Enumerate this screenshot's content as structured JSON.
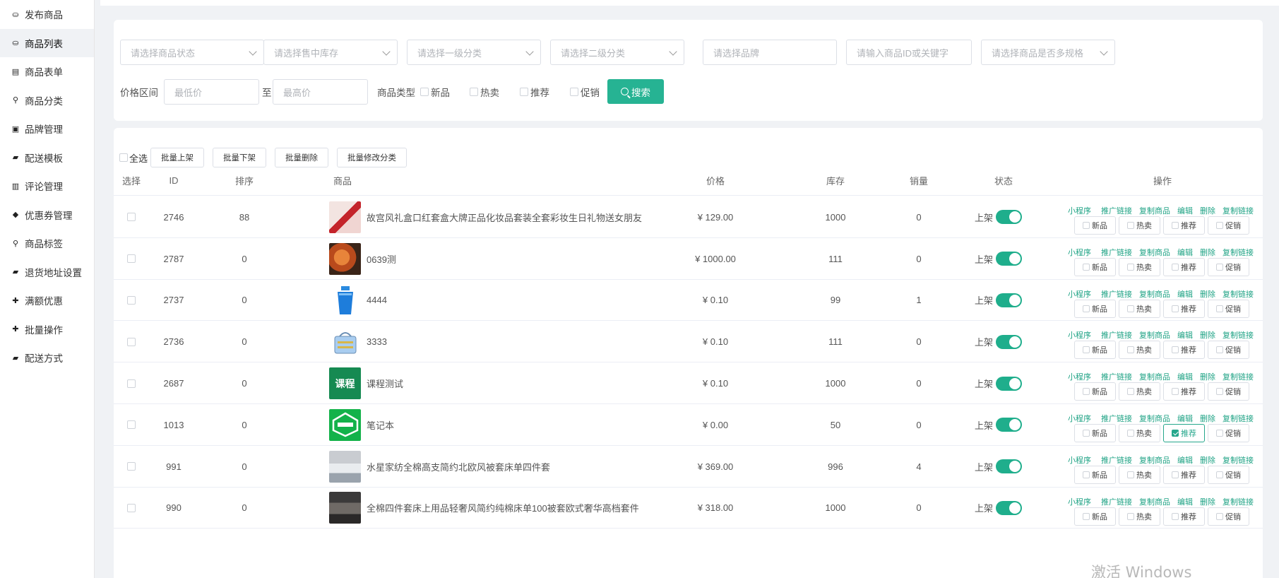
{
  "sidebar": {
    "items": [
      {
        "label": "发布商品",
        "icon": "coins-icon",
        "active": false
      },
      {
        "label": "商品列表",
        "icon": "coins-icon",
        "active": true
      },
      {
        "label": "商品表单",
        "icon": "file-excel-icon",
        "active": false
      },
      {
        "label": "商品分类",
        "icon": "sitemap-icon",
        "active": false
      },
      {
        "label": "品牌管理",
        "icon": "briefcase-icon",
        "active": false
      },
      {
        "label": "配送模板",
        "icon": "truck-icon",
        "active": false
      },
      {
        "label": "评论管理",
        "icon": "columns-icon",
        "active": false
      },
      {
        "label": "优惠券管理",
        "icon": "tags-icon",
        "active": false
      },
      {
        "label": "商品标签",
        "icon": "sitemap-icon",
        "active": false
      },
      {
        "label": "退货地址设置",
        "icon": "truck-icon",
        "active": false
      },
      {
        "label": "满额优惠",
        "icon": "gift-icon",
        "active": false
      },
      {
        "label": "批量操作",
        "icon": "gift-icon",
        "active": false
      },
      {
        "label": "配送方式",
        "icon": "truck-icon",
        "active": false
      }
    ]
  },
  "filters": {
    "status_placeholder": "请选择商品状态",
    "stock_placeholder": "请选择售中库存",
    "cat1_placeholder": "请选择一级分类",
    "cat2_placeholder": "请选择二级分类",
    "brand_placeholder": "请选择品牌",
    "keyword_placeholder": "请输入商品ID或关键字",
    "spec_placeholder": "请选择商品是否多规格",
    "price_label": "价格区间",
    "min_placeholder": "最低价",
    "to_label": "至",
    "max_placeholder": "最高价",
    "type_label": "商品类型",
    "type_new": "新品",
    "type_hot": "热卖",
    "type_rec": "推荐",
    "type_promo": "促销",
    "search_label": "搜索"
  },
  "toolbar": {
    "select_all": "全选",
    "batch_on": "批量上架",
    "batch_off": "批量下架",
    "batch_delete": "批量删除",
    "batch_category": "批量修改分类"
  },
  "table": {
    "headers": {
      "select": "选择",
      "id": "ID",
      "sort": "排序",
      "goods": "商品",
      "price": "价格",
      "stock": "库存",
      "sales": "销量",
      "status": "状态",
      "ops": "操作"
    },
    "ops_links": [
      "小程序",
      "推广链接",
      "复制商品",
      "编辑",
      "删除",
      "复制链接"
    ],
    "tag_labels": [
      "新品",
      "热卖",
      "推荐",
      "促销"
    ],
    "status_on": "上架",
    "rows": [
      {
        "id": "2746",
        "sort": "88",
        "name": "故宫风礼盒口红套盒大牌正品化妆品套装全套彩妆生日礼物送女朋友",
        "price": "¥ 129.00",
        "stock": "1000",
        "sales": "0",
        "thumb": "lipstick",
        "rec_checked": false
      },
      {
        "id": "2787",
        "sort": "0",
        "name": "0639测",
        "price": "¥ 1000.00",
        "stock": "111",
        "sales": "0",
        "thumb": "food",
        "rec_checked": false
      },
      {
        "id": "2737",
        "sort": "0",
        "name": "4444",
        "price": "¥ 0.10",
        "stock": "99",
        "sales": "1",
        "thumb": "cup",
        "rec_checked": false
      },
      {
        "id": "2736",
        "sort": "0",
        "name": "3333",
        "price": "¥ 0.10",
        "stock": "111",
        "sales": "0",
        "thumb": "basket",
        "rec_checked": false
      },
      {
        "id": "2687",
        "sort": "0",
        "name": "课程测试",
        "price": "¥ 0.10",
        "stock": "1000",
        "sales": "0",
        "thumb": "course",
        "thumb_text": "课程",
        "rec_checked": false
      },
      {
        "id": "1013",
        "sort": "0",
        "name": "笔记本",
        "price": "¥ 0.00",
        "stock": "50",
        "sales": "0",
        "thumb": "notebook",
        "rec_checked": true
      },
      {
        "id": "991",
        "sort": "0",
        "name": "水星家纺全棉高支简约北欧风被套床单四件套",
        "price": "¥ 369.00",
        "stock": "996",
        "sales": "4",
        "thumb": "bedding",
        "rec_checked": false
      },
      {
        "id": "990",
        "sort": "0",
        "name": "全棉四件套床上用品轻奢风简约纯棉床单100被套欧式奢华高档套件",
        "price": "¥ 318.00",
        "stock": "1000",
        "sales": "0",
        "thumb": "bedding2",
        "rec_checked": false
      }
    ]
  },
  "watermark": "激活 Windows",
  "colors": {
    "accent": "#26b393",
    "link": "#1fa385"
  }
}
